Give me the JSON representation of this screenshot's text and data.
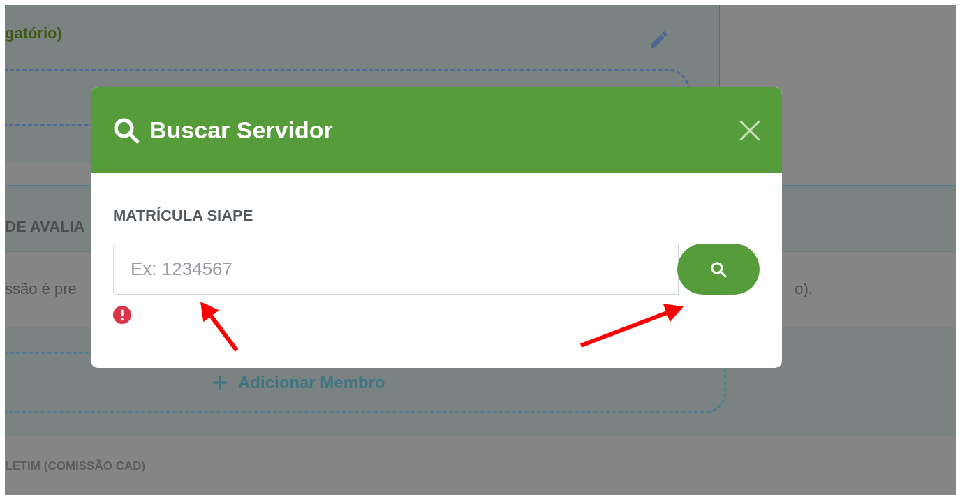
{
  "background": {
    "top_label": "gatório)",
    "section_title": "DE AVALIA",
    "description_start": "ssão é pre",
    "description_end": "o).",
    "add_member": "Adicionar Membro",
    "bottom_label": "LETIM (COMISSÃO CAD)"
  },
  "modal": {
    "title": "Buscar Servidor",
    "field_label": "MATRÍCULA SIAPE",
    "placeholder": "Ex: 1234567",
    "error": true
  }
}
